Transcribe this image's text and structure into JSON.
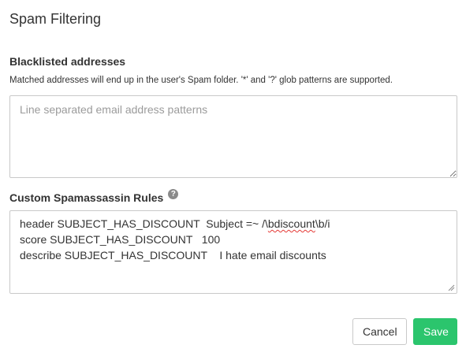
{
  "dialog": {
    "title": "Spam Filtering"
  },
  "blacklist": {
    "title": "Blacklisted addresses",
    "description": "Matched addresses will end up in the user's Spam folder. '*' and '?' glob patterns are supported.",
    "placeholder": "Line separated email address patterns",
    "value": ""
  },
  "rules": {
    "title": "Custom Spamassassin Rules",
    "help_icon": "question-circle-icon",
    "lines": [
      {
        "before": "header SUBJECT_HAS_DISCOUNT  Subject =~ /\\",
        "misspelled": "bdiscount",
        "after": "\\b/i"
      },
      {
        "before": "score SUBJECT_HAS_DISCOUNT   100",
        "misspelled": "",
        "after": ""
      },
      {
        "before": "describe SUBJECT_HAS_DISCOUNT    I hate email discounts",
        "misspelled": "",
        "after": ""
      }
    ]
  },
  "actions": {
    "cancel_label": "Cancel",
    "save_label": "Save"
  },
  "colors": {
    "save_button": "#2bc56d",
    "spellcheck_underline": "#e53935"
  }
}
